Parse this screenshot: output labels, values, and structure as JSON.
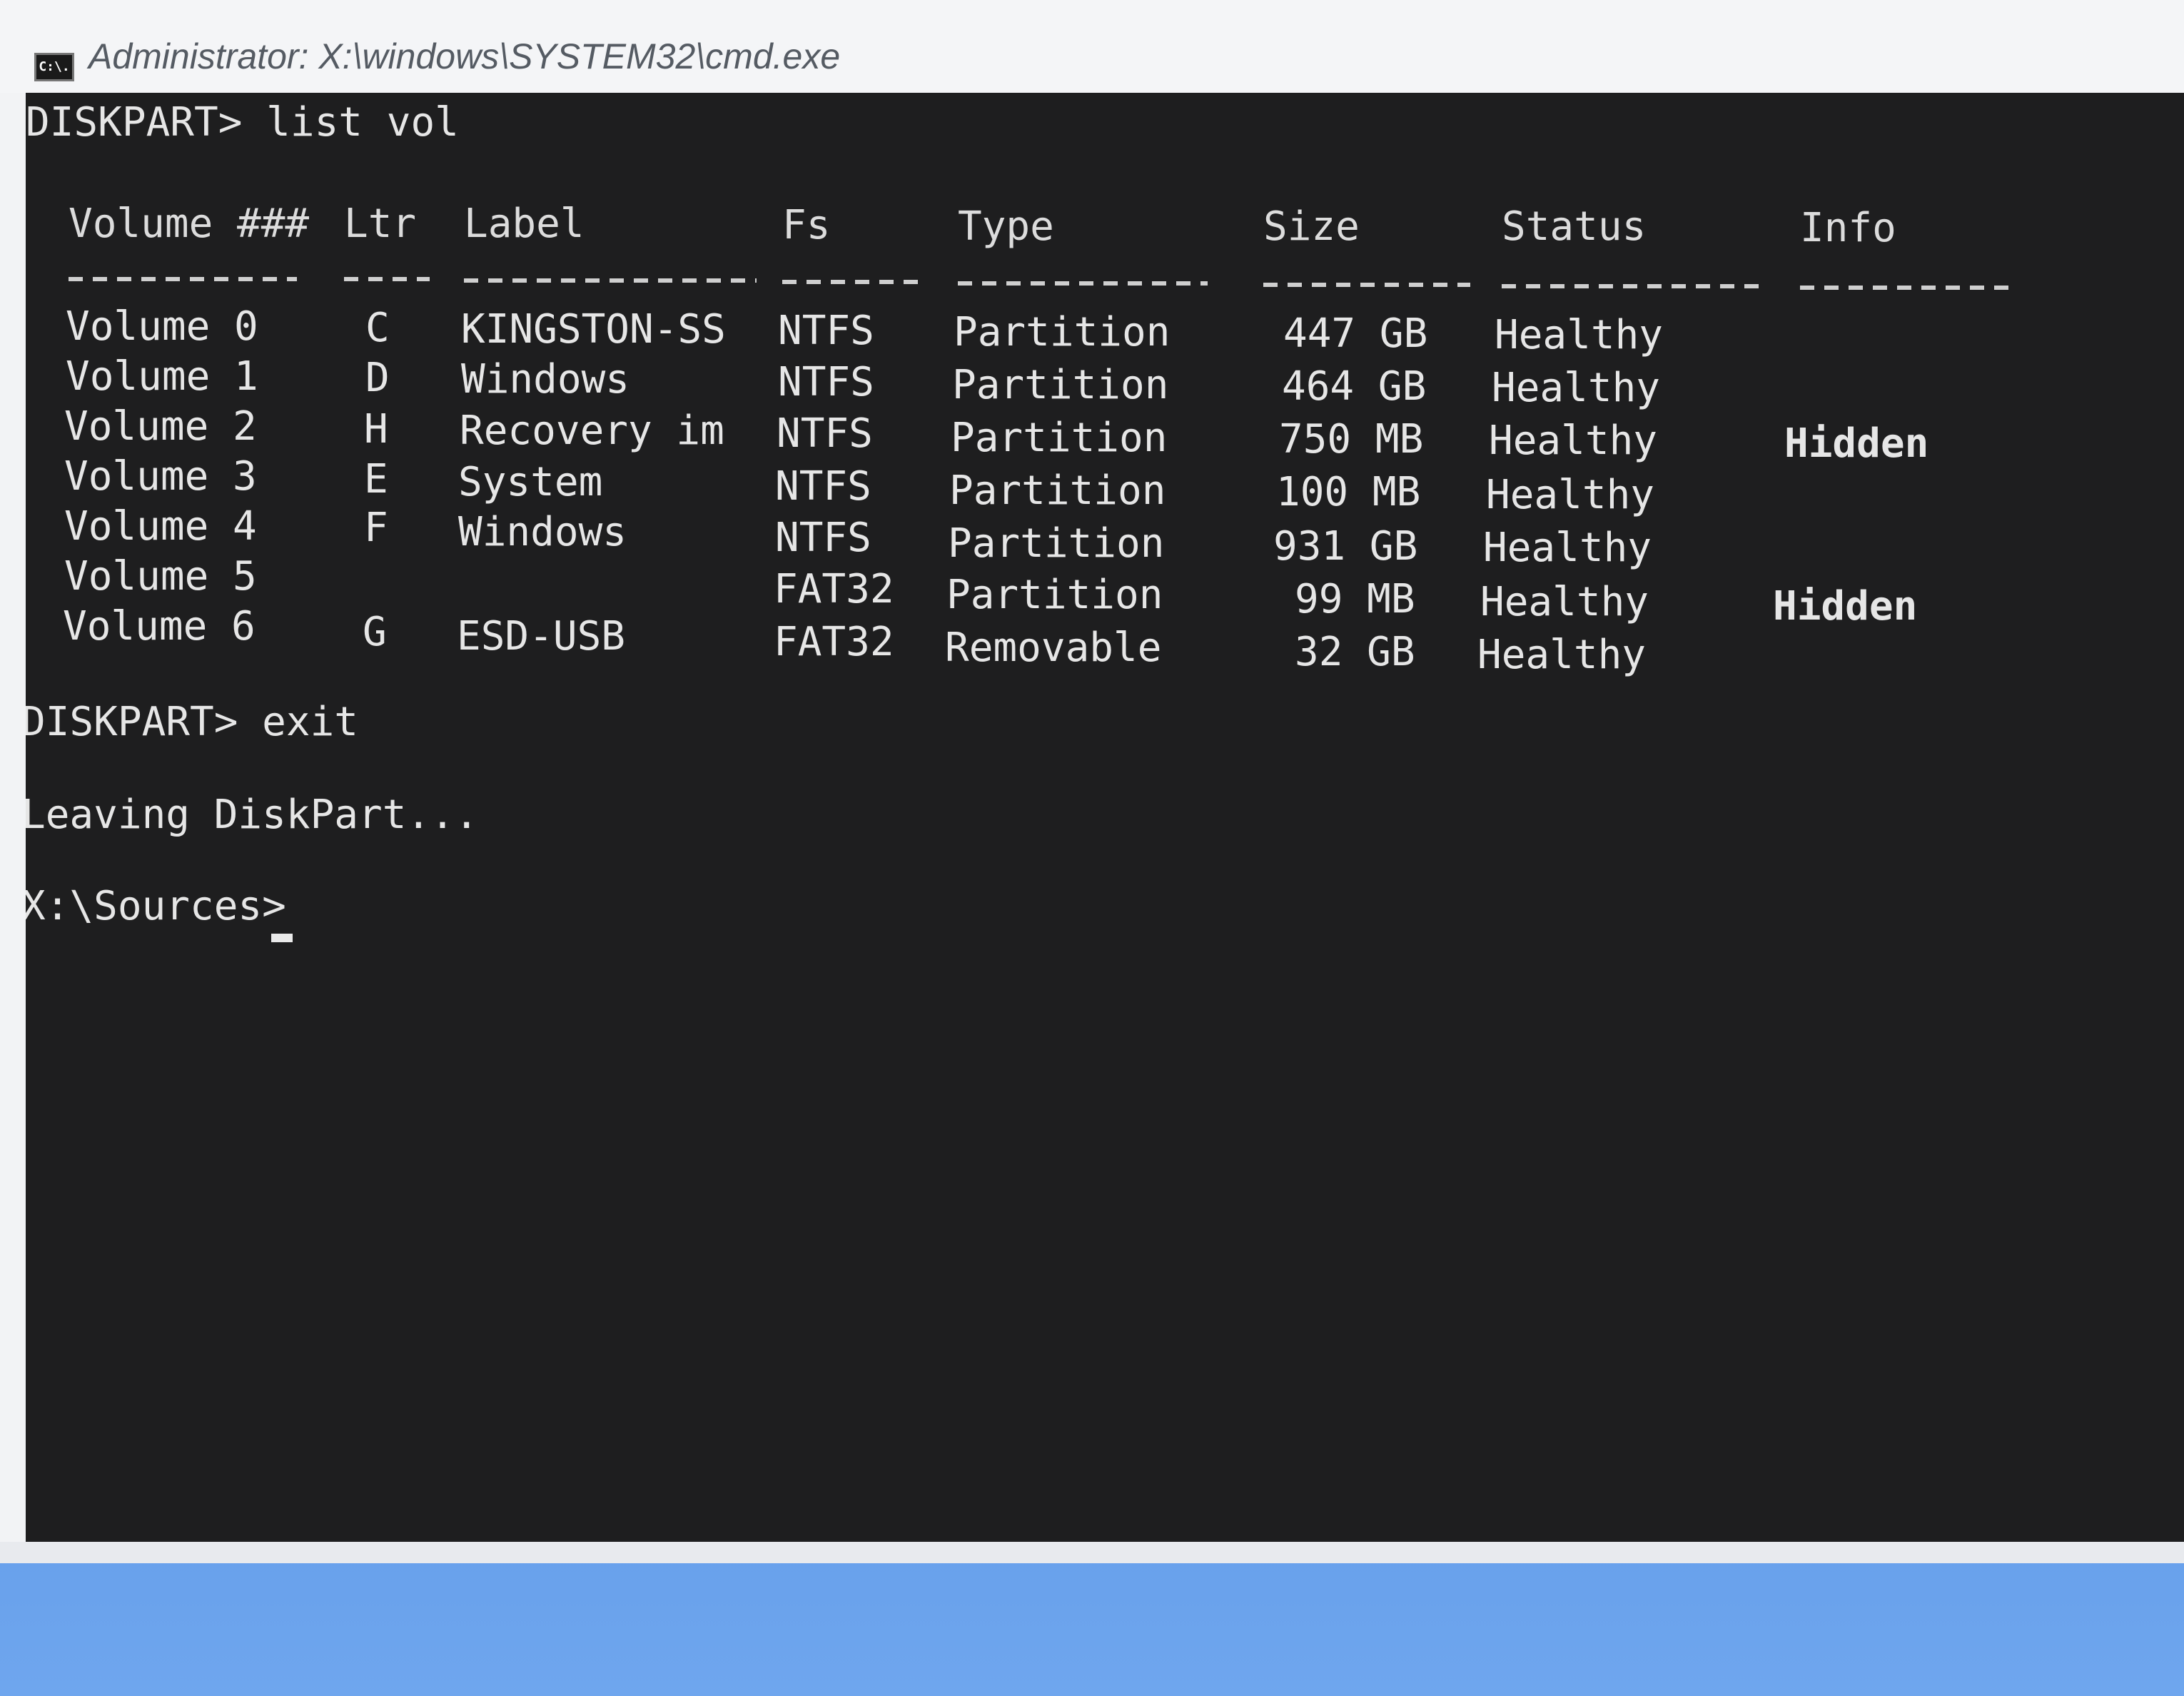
{
  "window": {
    "title": "Administrator: X:\\windows\\SYSTEM32\\cmd.exe",
    "icon_label": "C:\\.",
    "icon": "console-icon"
  },
  "console": {
    "command1": "DISKPART> list vol",
    "headers": [
      "Volume ###",
      "Ltr",
      "Label",
      "Fs",
      "Type",
      "Size",
      "Status",
      "Info"
    ],
    "rows": [
      {
        "volume": "Volume 0",
        "ltr": "C",
        "label": "KINGSTON-SS",
        "fs": "NTFS",
        "type": "Partition",
        "size": "447 GB",
        "status": "Healthy",
        "info": ""
      },
      {
        "volume": "Volume 1",
        "ltr": "D",
        "label": "Windows",
        "fs": "NTFS",
        "type": "Partition",
        "size": "464 GB",
        "status": "Healthy",
        "info": ""
      },
      {
        "volume": "Volume 2",
        "ltr": "H",
        "label": "Recovery im",
        "fs": "NTFS",
        "type": "Partition",
        "size": "750 MB",
        "status": "Healthy",
        "info": "Hidden"
      },
      {
        "volume": "Volume 3",
        "ltr": "E",
        "label": "System",
        "fs": "NTFS",
        "type": "Partition",
        "size": "100 MB",
        "status": "Healthy",
        "info": ""
      },
      {
        "volume": "Volume 4",
        "ltr": "F",
        "label": "Windows",
        "fs": "NTFS",
        "type": "Partition",
        "size": "931 GB",
        "status": "Healthy",
        "info": ""
      },
      {
        "volume": "Volume 5",
        "ltr": "",
        "label": "",
        "fs": "FAT32",
        "type": "Partition",
        "size": "99 MB",
        "status": "Healthy",
        "info": "Hidden"
      },
      {
        "volume": "Volume 6",
        "ltr": "G",
        "label": "ESD-USB",
        "fs": "FAT32",
        "type": "Removable",
        "size": "32 GB",
        "status": "Healthy",
        "info": ""
      }
    ],
    "command2": "DISKPART> exit",
    "message": "Leaving DiskPart...",
    "prompt": "X:\\Sources>"
  },
  "colors": {
    "console_bg": "#1e1e1f",
    "console_text": "#e6e6e6",
    "titlebar_bg": "#f4f5f7",
    "desktop_blue": "#3f7ccf"
  }
}
